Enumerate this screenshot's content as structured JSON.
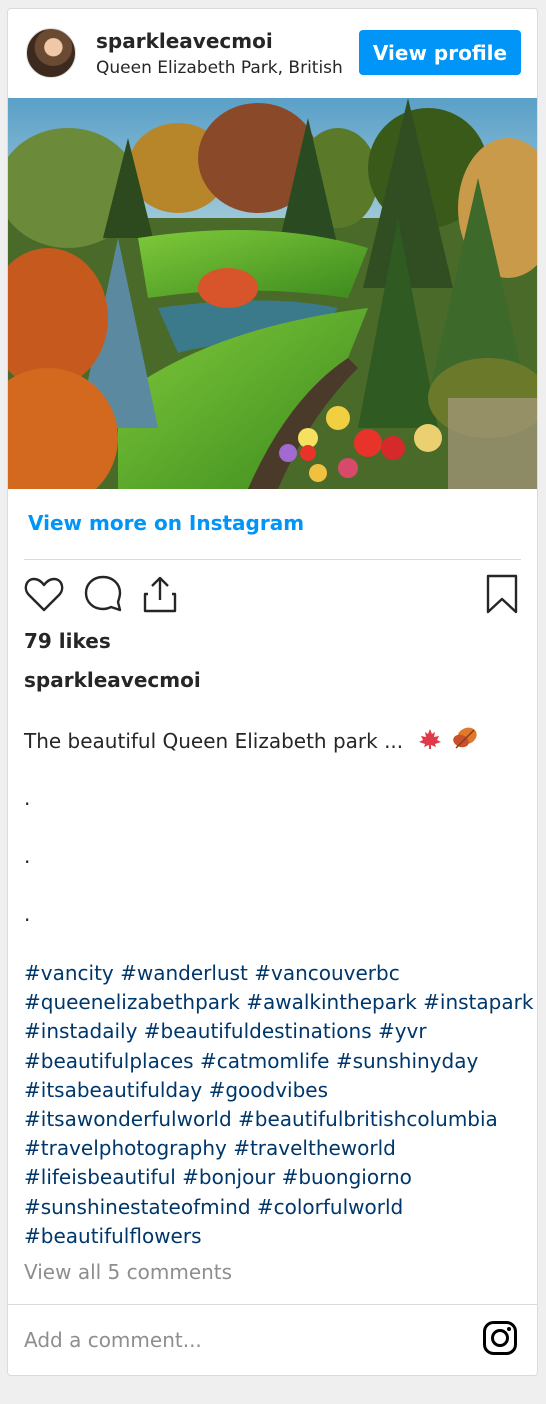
{
  "header": {
    "username": "sparkleavecmoi",
    "location": "Queen Elizabeth Park, British",
    "view_profile_label": "View profile"
  },
  "photo": {
    "alt": "Garden landscape with colorful trees, green lawn, pond and flower beds"
  },
  "view_more_label": "View more on Instagram",
  "actions": {
    "like_icon": "heart-icon",
    "comment_icon": "comment-icon",
    "share_icon": "share-icon",
    "save_icon": "bookmark-icon"
  },
  "likes_text": "79 likes",
  "caption": {
    "username": "sparkleavecmoi",
    "text": "The beautiful Queen Elizabeth park ...",
    "dots": [
      ".",
      ".",
      "."
    ],
    "hashtag_lines": [
      "#vancity #wanderlust #vancouverbc",
      "#queenelizabethpark #awalkinthepark #instapark",
      "#instadaily #beautifuldestinations #yvr",
      "#beautifulplaces #catmomlife #sunshinyday",
      "#itsabeautifulday #goodvibes",
      "#itsawonderfulworld #beautifulbritishcolumbia",
      "#travelphotography #traveltheworld",
      "#lifeisbeautiful #bonjour #buongiorno",
      "#sunshinestateofmind #colorfulworld",
      "#beautifulflowers"
    ]
  },
  "view_all_comments_label": "View all 5 comments",
  "add_comment_placeholder": "Add a comment...",
  "colors": {
    "accent": "#0095f6",
    "hashtag": "#00376b",
    "muted": "#8e8e8e"
  }
}
